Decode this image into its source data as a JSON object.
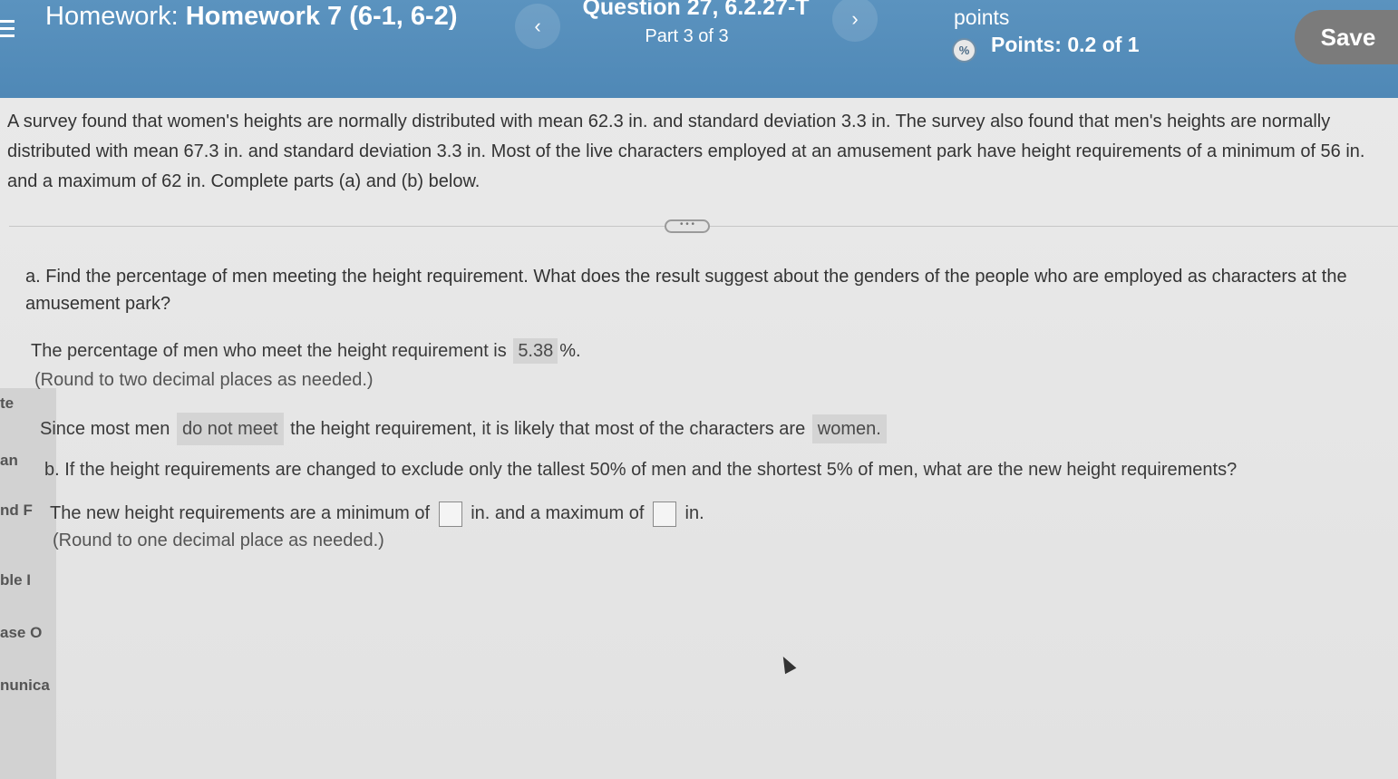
{
  "header": {
    "homework_label": "Homework:",
    "homework_name": "Homework 7 (6-1, 6-2)",
    "question_title": "Question 27, 6.2.27-T",
    "question_part": "Part 3 of 3",
    "points_label": "points",
    "points_value": "Points: 0.2 of 1",
    "save_label": "Save",
    "prev_icon": "‹",
    "next_icon": "›"
  },
  "problem": {
    "text": "A survey found that women's heights are normally distributed with mean 62.3 in. and standard deviation 3.3 in. The survey also found that men's heights are normally distributed with mean 67.3 in. and standard deviation 3.3 in. Most of the live characters employed at an amusement park have height requirements of a minimum of 56 in. and a maximum of 62 in. Complete parts (a) and (b) below."
  },
  "part_a": {
    "question": "a. Find the percentage of men meeting the height requirement. What does the result suggest about the genders of the people who are employed as characters at the amusement park?",
    "answer_prefix": "The percentage of men who meet the height requirement is",
    "answer_value": "5.38",
    "answer_suffix": "%.",
    "round_note": "(Round to two decimal places as needed.)",
    "since_prefix": "Since most men",
    "since_choice": "do not meet",
    "since_middle": "the height requirement, it is likely that most of the characters are",
    "since_answer": "women."
  },
  "part_b": {
    "question": "b. If the height requirements are changed to exclude only the tallest 50% of men and the shortest 5% of men, what are the new height requirements?",
    "answer_prefix": "The new height requirements are a minimum of",
    "answer_middle": "in. and a maximum of",
    "answer_suffix": "in.",
    "min_value": "",
    "max_value": "",
    "round_note": "(Round to one decimal place as needed.)"
  },
  "sidebar_cutoff": [
    "te",
    "an",
    "nd F",
    "ble I",
    "ase O",
    "nunica"
  ]
}
